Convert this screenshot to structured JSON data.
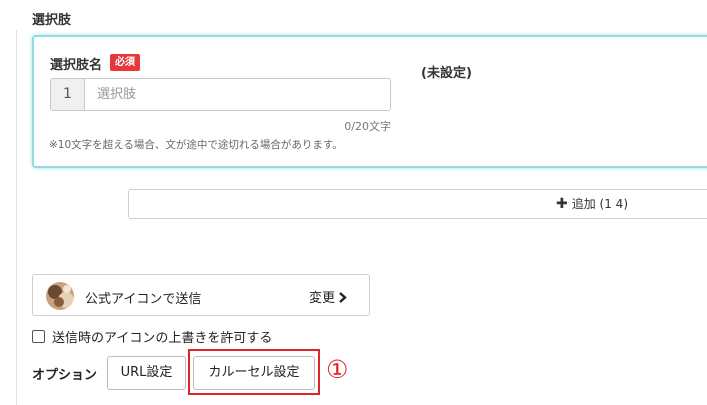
{
  "section": {
    "title": "選択肢"
  },
  "choice": {
    "label": "選択肢名",
    "required_badge": "必須",
    "index": "1",
    "placeholder": "選択肢",
    "value": "",
    "char_count": "0/20文字",
    "note": "※10文字を超える場合、文が途中で途切れる場合があります。",
    "preview": "(未設定)"
  },
  "add_button": {
    "label": "追加 (1 4)",
    "icon": "plus-icon"
  },
  "account": {
    "name": "公式アイコンで送信",
    "change_label": "変更",
    "change_icon": "chevron-right-icon"
  },
  "override": {
    "label": "送信時のアイコンの上書きを許可する",
    "checked": false
  },
  "options": {
    "label": "オプション",
    "url_button": "URL設定",
    "carousel_button": "カルーセル設定"
  },
  "annotation": {
    "marker": "①",
    "color": "#e0252a"
  },
  "colors": {
    "focus_border": "#8fdde3",
    "badge": "#e5383b",
    "annotation": "#e0252a"
  }
}
